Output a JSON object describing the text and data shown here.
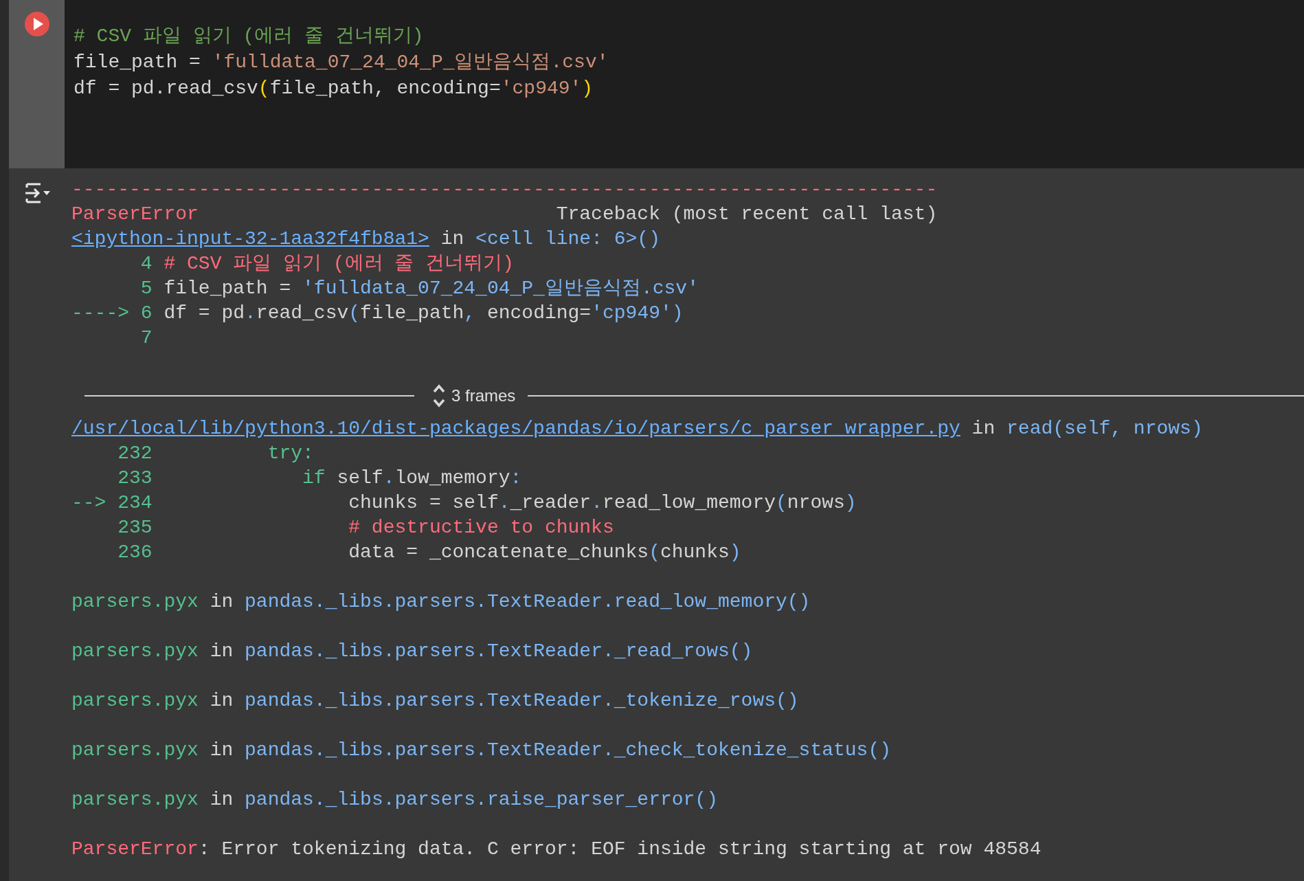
{
  "code_cell": {
    "lines": [
      [
        {
          "t": "# CSV 파일 읽기 (에러 줄 건너뛰기)",
          "kind": "comment"
        }
      ],
      [
        {
          "t": "file_path = ",
          "kind": "plain"
        },
        {
          "t": "'fulldata_07_24_04_P_일반음식점.csv'",
          "kind": "string"
        }
      ],
      [
        {
          "t": "df = pd.read_csv",
          "kind": "plain"
        },
        {
          "t": "(",
          "kind": "bracket"
        },
        {
          "t": "file_path, encoding=",
          "kind": "plain"
        },
        {
          "t": "'cp949'",
          "kind": "string"
        },
        {
          "t": ")",
          "kind": "bracket"
        }
      ]
    ]
  },
  "output": {
    "lines": [
      {
        "kind": "text",
        "tokens": [
          {
            "t": "---------------------------------------------------------------------------",
            "kind": "error"
          }
        ]
      },
      {
        "kind": "header",
        "tokens": [
          {
            "t": "ParserError",
            "kind": "error"
          },
          {
            "t": "Traceback (most recent call last)",
            "kind": "plain"
          }
        ]
      },
      {
        "kind": "text",
        "tokens": [
          {
            "t": "<ipython-input-32-1aa32f4fb8a1>",
            "kind": "link"
          },
          {
            "t": " in ",
            "kind": "plain"
          },
          {
            "t": "<cell line: 6>()",
            "kind": "blue"
          }
        ]
      },
      {
        "kind": "text",
        "tokens": [
          {
            "t": "      4 ",
            "kind": "green"
          },
          {
            "t": "# CSV 파일 읽기 (에러 줄 건너뛰기)",
            "kind": "error"
          }
        ]
      },
      {
        "kind": "text",
        "tokens": [
          {
            "t": "      5 ",
            "kind": "green"
          },
          {
            "t": "file_path = ",
            "kind": "plain"
          },
          {
            "t": "'fulldata_07_24_04_P_일반음식점.csv'",
            "kind": "blue"
          }
        ]
      },
      {
        "kind": "text",
        "tokens": [
          {
            "t": "----> 6",
            "kind": "green"
          },
          {
            "t": " df = pd",
            "kind": "plain"
          },
          {
            "t": ".",
            "kind": "blue"
          },
          {
            "t": "read_csv",
            "kind": "plain"
          },
          {
            "t": "(",
            "kind": "blue"
          },
          {
            "t": "file_path",
            "kind": "plain"
          },
          {
            "t": ",",
            "kind": "blue"
          },
          {
            "t": " encoding=",
            "kind": "plain"
          },
          {
            "t": "'cp949')",
            "kind": "blue"
          }
        ]
      },
      {
        "kind": "text",
        "tokens": [
          {
            "t": "      7",
            "kind": "green"
          }
        ]
      },
      {
        "kind": "blank"
      },
      {
        "kind": "frames",
        "label": "3 frames"
      },
      {
        "kind": "text",
        "tokens": [
          {
            "t": "/usr/local/lib/python3.10/dist-packages/pandas/io/parsers/c_parser_wrapper.py",
            "kind": "link"
          },
          {
            "t": " in ",
            "kind": "plain"
          },
          {
            "t": "read(self, nrows)",
            "kind": "blue"
          }
        ]
      },
      {
        "kind": "text",
        "tokens": [
          {
            "t": "    232          try:",
            "kind": "green"
          }
        ]
      },
      {
        "kind": "text",
        "tokens": [
          {
            "t": "    233             ",
            "kind": "green"
          },
          {
            "t": "if",
            "kind": "green"
          },
          {
            "t": " self",
            "kind": "plain"
          },
          {
            "t": ".",
            "kind": "blue"
          },
          {
            "t": "low_memory",
            "kind": "plain"
          },
          {
            "t": ":",
            "kind": "blue"
          }
        ]
      },
      {
        "kind": "text",
        "tokens": [
          {
            "t": "--> 234                 ",
            "kind": "green"
          },
          {
            "t": "chunks = self",
            "kind": "plain"
          },
          {
            "t": ".",
            "kind": "blue"
          },
          {
            "t": "_reader",
            "kind": "plain"
          },
          {
            "t": ".",
            "kind": "blue"
          },
          {
            "t": "read_low_memory",
            "kind": "plain"
          },
          {
            "t": "(",
            "kind": "blue"
          },
          {
            "t": "nrows",
            "kind": "plain"
          },
          {
            "t": ")",
            "kind": "blue"
          }
        ]
      },
      {
        "kind": "text",
        "tokens": [
          {
            "t": "    235                 ",
            "kind": "green"
          },
          {
            "t": "# destructive to chunks",
            "kind": "error"
          }
        ]
      },
      {
        "kind": "text",
        "tokens": [
          {
            "t": "    236                 ",
            "kind": "green"
          },
          {
            "t": "data = _concatenate_chunks",
            "kind": "plain"
          },
          {
            "t": "(",
            "kind": "blue"
          },
          {
            "t": "chunks",
            "kind": "plain"
          },
          {
            "t": ")",
            "kind": "blue"
          }
        ]
      },
      {
        "kind": "blank"
      },
      {
        "kind": "text",
        "tokens": [
          {
            "t": "parsers.pyx",
            "kind": "green"
          },
          {
            "t": " in ",
            "kind": "plain"
          },
          {
            "t": "pandas._libs.parsers.TextReader.read_low_memory()",
            "kind": "blue"
          }
        ]
      },
      {
        "kind": "blank"
      },
      {
        "kind": "text",
        "tokens": [
          {
            "t": "parsers.pyx",
            "kind": "green"
          },
          {
            "t": " in ",
            "kind": "plain"
          },
          {
            "t": "pandas._libs.parsers.TextReader._read_rows()",
            "kind": "blue"
          }
        ]
      },
      {
        "kind": "blank"
      },
      {
        "kind": "text",
        "tokens": [
          {
            "t": "parsers.pyx",
            "kind": "green"
          },
          {
            "t": " in ",
            "kind": "plain"
          },
          {
            "t": "pandas._libs.parsers.TextReader._tokenize_rows()",
            "kind": "blue"
          }
        ]
      },
      {
        "kind": "blank"
      },
      {
        "kind": "text",
        "tokens": [
          {
            "t": "parsers.pyx",
            "kind": "green"
          },
          {
            "t": " in ",
            "kind": "plain"
          },
          {
            "t": "pandas._libs.parsers.TextReader._check_tokenize_status()",
            "kind": "blue"
          }
        ]
      },
      {
        "kind": "blank"
      },
      {
        "kind": "text",
        "tokens": [
          {
            "t": "parsers.pyx",
            "kind": "green"
          },
          {
            "t": " in ",
            "kind": "plain"
          },
          {
            "t": "pandas._libs.parsers.raise_parser_error()",
            "kind": "blue"
          }
        ]
      },
      {
        "kind": "blank"
      },
      {
        "kind": "text",
        "tokens": [
          {
            "t": "ParserError",
            "kind": "error"
          },
          {
            "t": ": Error tokenizing data. C error: EOF inside string starting at row 48584",
            "kind": "plain"
          }
        ]
      }
    ]
  }
}
